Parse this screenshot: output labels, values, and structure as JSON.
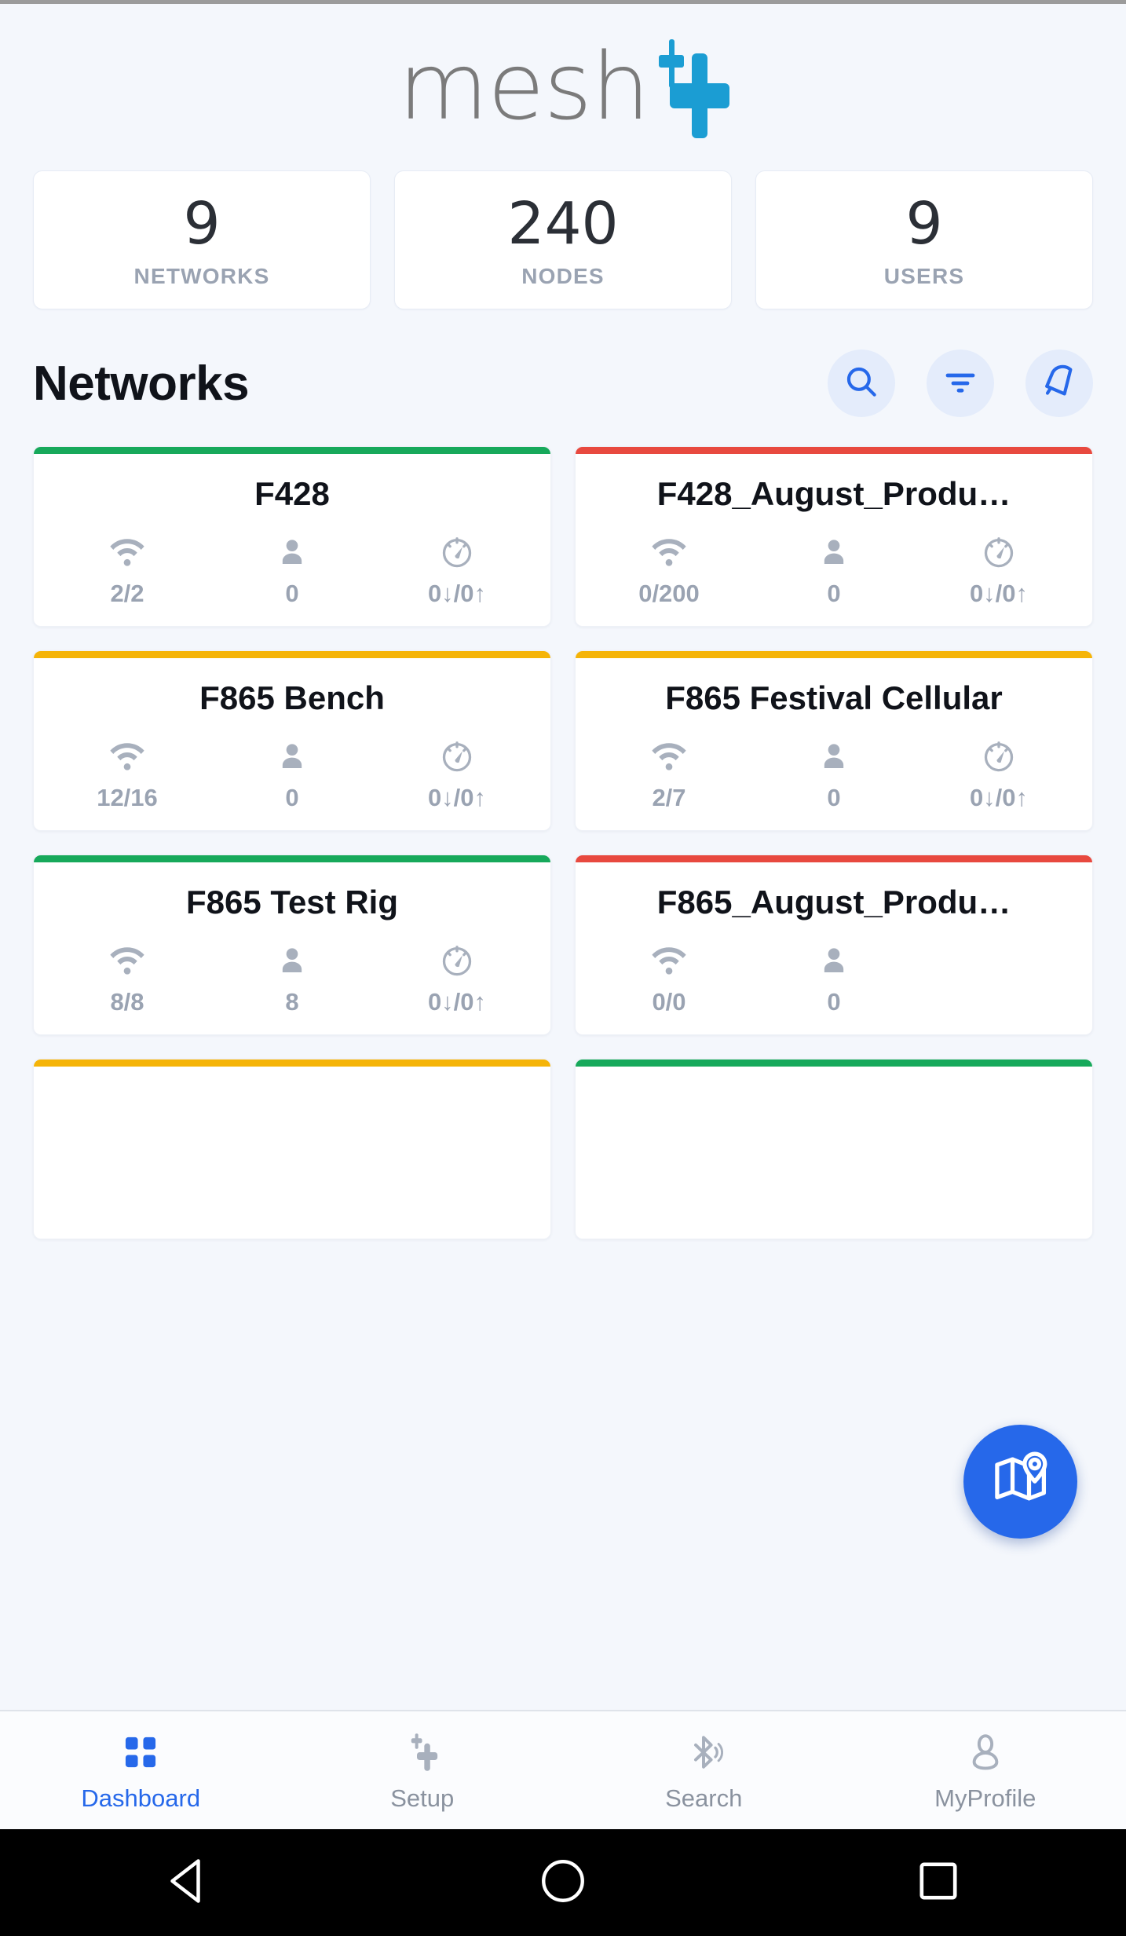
{
  "app": {
    "logo_text": "mesh",
    "logo_accent_color": "#1b9dd3"
  },
  "stats": [
    {
      "value": "9",
      "label": "NETWORKS"
    },
    {
      "value": "240",
      "label": "NODES"
    },
    {
      "value": "9",
      "label": "USERS"
    }
  ],
  "section": {
    "title": "Networks",
    "actions": [
      {
        "name": "search-icon",
        "label": "Search"
      },
      {
        "name": "filter-icon",
        "label": "Filter"
      },
      {
        "name": "bell-icon",
        "label": "Notifications"
      }
    ],
    "action_bg_color": "#e4ecfb",
    "action_icon_color": "#2668ea"
  },
  "status_colors": {
    "green": "#17a95b",
    "red": "#e8493f",
    "yellow": "#f5b408"
  },
  "metric_icons": {
    "nodes": "wifi-icon",
    "users": "person-icon",
    "throughput": "speedometer-icon"
  },
  "networks": [
    {
      "name": "F428",
      "status": "green",
      "nodes": "2/2",
      "users": "0",
      "throughput": "0↓/0↑"
    },
    {
      "name": "F428_August_Produ…",
      "status": "red",
      "nodes": "0/200",
      "users": "0",
      "throughput": "0↓/0↑"
    },
    {
      "name": "F865 Bench",
      "status": "yellow",
      "nodes": "12/16",
      "users": "0",
      "throughput": "0↓/0↑"
    },
    {
      "name": "F865 Festival Cellular",
      "status": "yellow",
      "nodes": "2/7",
      "users": "0",
      "throughput": "0↓/0↑"
    },
    {
      "name": "F865 Test Rig",
      "status": "green",
      "nodes": "8/8",
      "users": "8",
      "throughput": "0↓/0↑"
    },
    {
      "name": "F865_August_Produ…",
      "status": "red",
      "nodes": "0/0",
      "users": "0",
      "throughput": ""
    },
    {
      "name": "",
      "status": "yellow",
      "nodes": "",
      "users": "",
      "throughput": ""
    },
    {
      "name": "",
      "status": "green",
      "nodes": "",
      "users": "",
      "throughput": ""
    }
  ],
  "fab": {
    "icon": "map-pin-icon",
    "color": "#2668ea"
  },
  "bottom_nav": {
    "active_color": "#2668ea",
    "inactive_color": "#8a929f",
    "items": [
      {
        "label": "Dashboard",
        "icon": "grid-icon",
        "active": true
      },
      {
        "label": "Setup",
        "icon": "mesh-plus-icon",
        "active": false
      },
      {
        "label": "Search",
        "icon": "bluetooth-icon",
        "active": false
      },
      {
        "label": "MyProfile",
        "icon": "person-icon",
        "active": false
      }
    ]
  },
  "system_nav": {
    "items": [
      {
        "label": "Back",
        "icon": "back-triangle-icon"
      },
      {
        "label": "Home",
        "icon": "home-circle-icon"
      },
      {
        "label": "Recent",
        "icon": "recents-square-icon"
      }
    ]
  }
}
